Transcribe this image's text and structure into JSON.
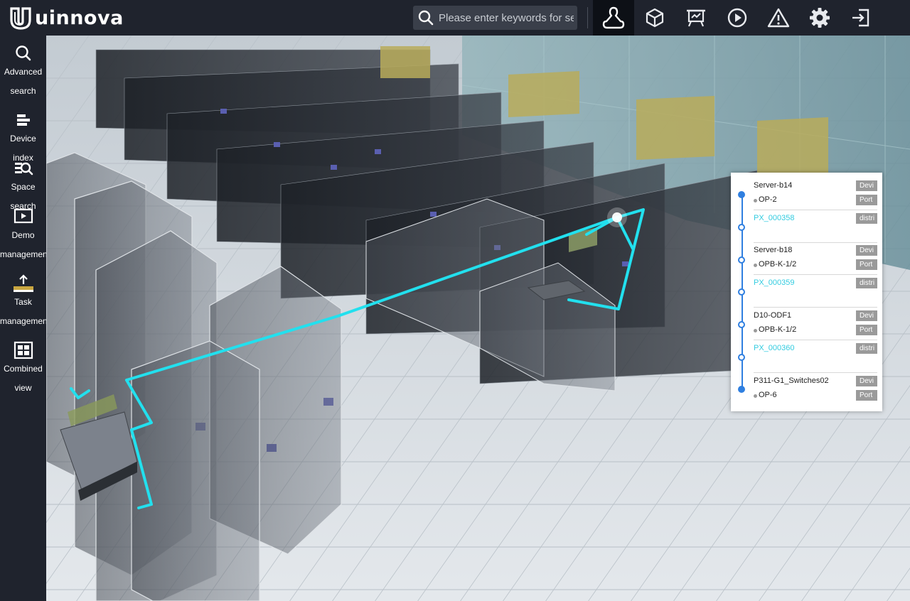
{
  "brand": {
    "name": "uinnova"
  },
  "search": {
    "placeholder": "Please enter keywords for search"
  },
  "topnav": [
    {
      "icon": "topology-icon",
      "active": true
    },
    {
      "icon": "cube-icon",
      "active": false
    },
    {
      "icon": "board-icon",
      "active": false
    },
    {
      "icon": "play-icon",
      "active": false
    },
    {
      "icon": "warning-icon",
      "active": false
    },
    {
      "icon": "gear-icon",
      "active": false
    },
    {
      "icon": "logout-icon",
      "active": false
    }
  ],
  "sidebar": {
    "items": [
      {
        "label1": "Advanced",
        "label2": "search",
        "icon": "search-icon"
      },
      {
        "label1": "Device index",
        "label2": "",
        "icon": "device-index-icon"
      },
      {
        "label1": "Space search",
        "label2": "",
        "icon": "space-search-icon"
      },
      {
        "label1": "Demo",
        "label2": "management",
        "icon": "demo-icon"
      },
      {
        "label1": "Task",
        "label2": "management",
        "icon": "task-icon"
      },
      {
        "label1": "Combined",
        "label2": "view",
        "icon": "combined-view-icon"
      }
    ]
  },
  "route_panel": {
    "groups": [
      {
        "device": "Server-b14",
        "device_tag": "Devi",
        "port": "OP-2",
        "port_tag": "Port",
        "link": "PX_000358",
        "link_tag": "distri"
      },
      {
        "device": "Server-b18",
        "device_tag": "Devi",
        "port": "OPB-K-1/2",
        "port_tag": "Port",
        "link": "PX_000359",
        "link_tag": "distri"
      },
      {
        "device": "D10-ODF1",
        "device_tag": "Devi",
        "port": "OPB-K-1/2",
        "port_tag": "Port",
        "link": "PX_000360",
        "link_tag": "distri"
      },
      {
        "device": "P311-G1_Switches02",
        "device_tag": "Devi",
        "port": "OP-6",
        "port_tag": "Port"
      }
    ]
  },
  "colors": {
    "accent": "#2f7fe0",
    "link": "#33cce0",
    "cable": "#22e0ee",
    "topbar": "#1f232d"
  }
}
